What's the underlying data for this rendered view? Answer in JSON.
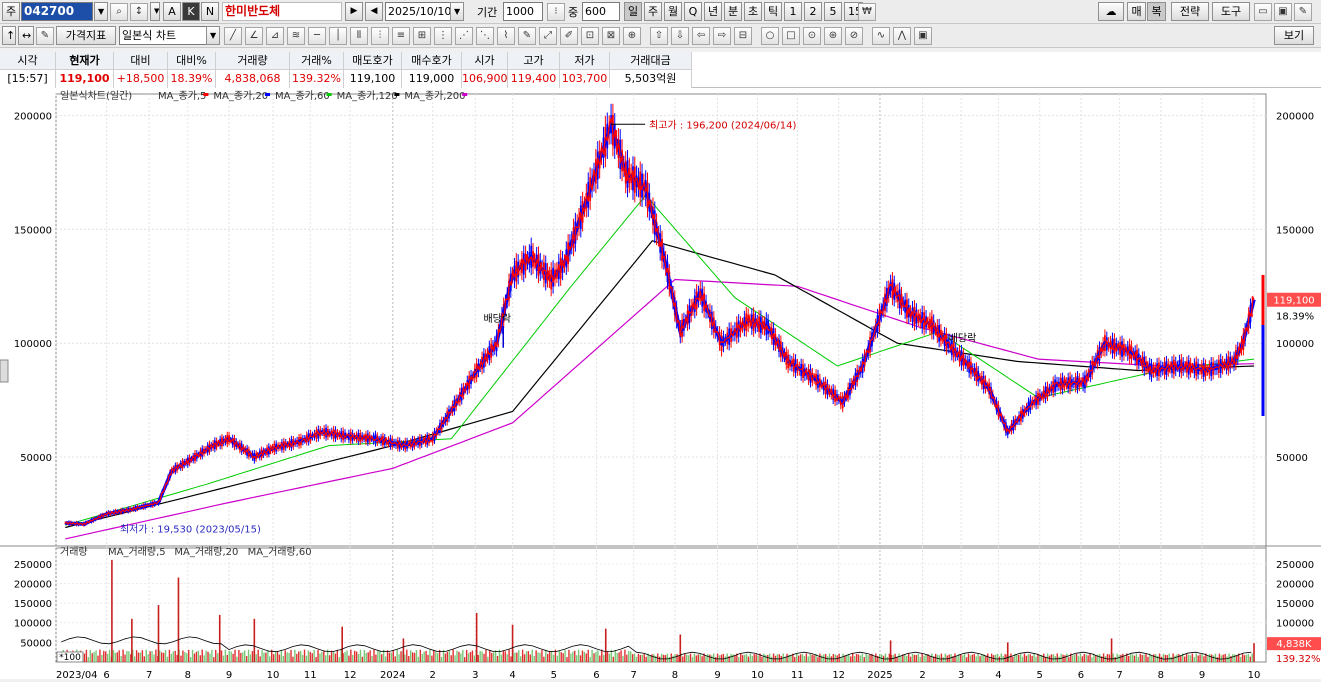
{
  "toolbar": {
    "prefix_label": "주",
    "stock_code": "042700",
    "btn_a": "A",
    "btn_k": "K",
    "btn_n": "N",
    "stock_name": "한미반도체",
    "date": "2025/10/10",
    "period_label": "기간",
    "period_value": "1000",
    "count_label": "중",
    "count_value": "600",
    "periods": [
      "일",
      "주",
      "월",
      "Q",
      "년",
      "분",
      "초",
      "틱",
      "1",
      "2",
      "5",
      "15"
    ],
    "right_buttons": [
      "매",
      "복",
      "전략",
      "도구"
    ],
    "indicator_btn": "가격지표",
    "chart_type": "일본식 차트",
    "view_btn": "보기"
  },
  "quote": {
    "headers": [
      "시각",
      "현재가",
      "대비",
      "대비%",
      "거래량",
      "거래%",
      "매도호가",
      "매수호가",
      "시가",
      "고가",
      "저가",
      "거래대금"
    ],
    "values": [
      "[15:57]",
      "119,100",
      "+18,500",
      "18.39%",
      "4,838,068",
      "139.32%",
      "119,100",
      "119,000",
      "106,900",
      "119,400",
      "103,700",
      "5,503억원"
    ]
  },
  "chart_data": {
    "type": "line",
    "title": "일본식차트(일간)",
    "legend": [
      "MA_종가,5",
      "MA_종가,20",
      "MA_종가,60",
      "MA_종가,120",
      "MA_종가,200"
    ],
    "colors": {
      "price_up": "#ff0000",
      "price_down": "#0000ff",
      "ma5": "#ff0000",
      "ma20": "#0000ff",
      "ma60": "#00cc00",
      "ma120": "#000000",
      "ma200": "#cc00cc"
    },
    "y_ticks": [
      50000,
      100000,
      150000,
      200000
    ],
    "y_tick_labels": [
      "50000",
      "100000",
      "150000",
      "200000"
    ],
    "ylim": [
      10000,
      206000
    ],
    "x_labels": [
      "2023/04",
      "6",
      "7",
      "8",
      "9",
      "10",
      "11",
      "12",
      "2024",
      "2",
      "3",
      "4",
      "5",
      "6",
      "7",
      "8",
      "9",
      "10",
      "11",
      "12",
      "2025",
      "2",
      "3",
      "4",
      "5",
      "6",
      "7",
      "8",
      "9",
      "10"
    ],
    "x_dates": [
      "2023-04-24",
      "2023-06-01",
      "2023-07-03",
      "2023-08-01",
      "2023-09-01",
      "2023-10-04",
      "2023-11-01",
      "2023-12-01",
      "2024-01-02",
      "2024-02-01",
      "2024-03-04",
      "2024-04-01",
      "2024-05-02",
      "2024-06-03",
      "2024-07-01",
      "2024-08-01",
      "2024-09-02",
      "2024-10-02",
      "2024-11-01",
      "2024-12-02",
      "2025-01-02",
      "2025-02-03",
      "2025-03-04",
      "2025-04-01",
      "2025-05-02",
      "2025-06-02",
      "2025-07-01",
      "2025-08-01",
      "2025-09-01",
      "2025-10-10"
    ],
    "price_points": [
      {
        "date": "2023-05-01",
        "close": 21000
      },
      {
        "date": "2023-05-15",
        "close": 20500
      },
      {
        "date": "2023-06-01",
        "close": 25000
      },
      {
        "date": "2023-06-20",
        "close": 27000
      },
      {
        "date": "2023-07-10",
        "close": 30000
      },
      {
        "date": "2023-07-20",
        "close": 44000
      },
      {
        "date": "2023-08-01",
        "close": 48000
      },
      {
        "date": "2023-08-20",
        "close": 55000
      },
      {
        "date": "2023-09-01",
        "close": 58000
      },
      {
        "date": "2023-09-20",
        "close": 50000
      },
      {
        "date": "2023-10-05",
        "close": 54000
      },
      {
        "date": "2023-10-25",
        "close": 57000
      },
      {
        "date": "2023-11-10",
        "close": 61000
      },
      {
        "date": "2023-11-30",
        "close": 59000
      },
      {
        "date": "2023-12-20",
        "close": 58000
      },
      {
        "date": "2024-01-10",
        "close": 55000
      },
      {
        "date": "2024-02-01",
        "close": 58000
      },
      {
        "date": "2024-02-20",
        "close": 75000
      },
      {
        "date": "2024-03-05",
        "close": 88000
      },
      {
        "date": "2024-03-20",
        "close": 100000
      },
      {
        "date": "2024-04-01",
        "close": 130000
      },
      {
        "date": "2024-04-15",
        "close": 138000
      },
      {
        "date": "2024-04-30",
        "close": 128000
      },
      {
        "date": "2024-05-10",
        "close": 135000
      },
      {
        "date": "2024-05-25",
        "close": 160000
      },
      {
        "date": "2024-06-14",
        "close": 196200
      },
      {
        "date": "2024-06-25",
        "close": 175000
      },
      {
        "date": "2024-07-10",
        "close": 168000
      },
      {
        "date": "2024-07-25",
        "close": 135000
      },
      {
        "date": "2024-08-05",
        "close": 105000
      },
      {
        "date": "2024-08-20",
        "close": 122000
      },
      {
        "date": "2024-09-05",
        "close": 100000
      },
      {
        "date": "2024-09-25",
        "close": 110000
      },
      {
        "date": "2024-10-10",
        "close": 107000
      },
      {
        "date": "2024-10-25",
        "close": 92000
      },
      {
        "date": "2024-11-15",
        "close": 84000
      },
      {
        "date": "2024-12-05",
        "close": 74000
      },
      {
        "date": "2024-12-20",
        "close": 90000
      },
      {
        "date": "2025-01-10",
        "close": 125000
      },
      {
        "date": "2025-01-25",
        "close": 113000
      },
      {
        "date": "2025-02-10",
        "close": 108000
      },
      {
        "date": "2025-02-25",
        "close": 98000
      },
      {
        "date": "2025-03-10",
        "close": 90000
      },
      {
        "date": "2025-03-25",
        "close": 80000
      },
      {
        "date": "2025-04-08",
        "close": 61000
      },
      {
        "date": "2025-04-25",
        "close": 73000
      },
      {
        "date": "2025-05-15",
        "close": 82000
      },
      {
        "date": "2025-06-05",
        "close": 83000
      },
      {
        "date": "2025-06-20",
        "close": 100000
      },
      {
        "date": "2025-07-10",
        "close": 96000
      },
      {
        "date": "2025-07-25",
        "close": 88000
      },
      {
        "date": "2025-08-15",
        "close": 90000
      },
      {
        "date": "2025-09-05",
        "close": 88000
      },
      {
        "date": "2025-09-25",
        "close": 92000
      },
      {
        "date": "2025-10-02",
        "close": 100600
      },
      {
        "date": "2025-10-10",
        "close": 119100
      }
    ],
    "ma120_points": [
      {
        "date": "2023-05-01",
        "v": 19000
      },
      {
        "date": "2023-09-01",
        "v": 37000
      },
      {
        "date": "2024-01-02",
        "v": 55000
      },
      {
        "date": "2024-04-01",
        "v": 70000
      },
      {
        "date": "2024-07-15",
        "v": 145000
      },
      {
        "date": "2024-10-15",
        "v": 130000
      },
      {
        "date": "2025-01-15",
        "v": 100000
      },
      {
        "date": "2025-04-15",
        "v": 92000
      },
      {
        "date": "2025-07-15",
        "v": 88000
      },
      {
        "date": "2025-10-10",
        "v": 90000
      }
    ],
    "ma200_points": [
      {
        "date": "2023-05-01",
        "v": 14000
      },
      {
        "date": "2023-09-01",
        "v": 30000
      },
      {
        "date": "2024-01-02",
        "v": 45000
      },
      {
        "date": "2024-04-01",
        "v": 65000
      },
      {
        "date": "2024-08-01",
        "v": 128000
      },
      {
        "date": "2024-11-01",
        "v": 125000
      },
      {
        "date": "2025-02-01",
        "v": 107000
      },
      {
        "date": "2025-05-01",
        "v": 93000
      },
      {
        "date": "2025-08-01",
        "v": 90000
      },
      {
        "date": "2025-10-10",
        "v": 91000
      }
    ],
    "ma60_points": [
      {
        "date": "2023-05-01",
        "v": 20000
      },
      {
        "date": "2023-08-15",
        "v": 38000
      },
      {
        "date": "2023-11-15",
        "v": 55000
      },
      {
        "date": "2024-02-15",
        "v": 58000
      },
      {
        "date": "2024-05-15",
        "v": 125000
      },
      {
        "date": "2024-07-10",
        "v": 165000
      },
      {
        "date": "2024-09-15",
        "v": 120000
      },
      {
        "date": "2024-12-01",
        "v": 90000
      },
      {
        "date": "2025-02-15",
        "v": 105000
      },
      {
        "date": "2025-05-01",
        "v": 76000
      },
      {
        "date": "2025-08-01",
        "v": 88000
      },
      {
        "date": "2025-10-10",
        "v": 93000
      }
    ],
    "annotations": {
      "high_label": "최고가 : 196,200 (2024/06/14)",
      "high_date": "2024-06-14",
      "high_value": 196200,
      "low_label": "최저가 : 19,530 (2023/05/15)",
      "low_date": "2023-05-15",
      "low_value": 19530,
      "dividend_1": "배당락",
      "dividend_1_date": "2024-03-25",
      "dividend_2": "배당락",
      "dividend_2_date": "2025-03-05"
    },
    "last_price_label": "119,100",
    "last_pct_label": "18.39%",
    "volume": {
      "title": "거래량",
      "legend": [
        "MA_거래량,5",
        "MA_거래량,20",
        "MA_거래량,60"
      ],
      "y_ticks": [
        50000,
        100000,
        150000,
        200000,
        250000
      ],
      "y_tick_labels": [
        "50000",
        "100000",
        "150000",
        "200000",
        "250000"
      ],
      "ylim": [
        0,
        270000
      ],
      "unit_label": "*100",
      "last_volume_label": "4,838K",
      "last_volume_pct": "139.32%",
      "spikes": [
        {
          "date": "2023-06-05",
          "v": 260000
        },
        {
          "date": "2023-06-20",
          "v": 110000
        },
        {
          "date": "2023-07-10",
          "v": 145000
        },
        {
          "date": "2023-07-25",
          "v": 215000
        },
        {
          "date": "2023-08-25",
          "v": 120000
        },
        {
          "date": "2023-09-20",
          "v": 110000
        },
        {
          "date": "2023-11-25",
          "v": 90000
        },
        {
          "date": "2024-01-10",
          "v": 60000
        },
        {
          "date": "2024-03-05",
          "v": 125000
        },
        {
          "date": "2024-04-01",
          "v": 95000
        },
        {
          "date": "2024-06-10",
          "v": 85000
        },
        {
          "date": "2024-08-05",
          "v": 70000
        },
        {
          "date": "2025-01-10",
          "v": 55000
        },
        {
          "date": "2025-04-08",
          "v": 50000
        },
        {
          "date": "2025-06-25",
          "v": 60000
        },
        {
          "date": "2025-10-10",
          "v": 48000
        }
      ]
    }
  }
}
